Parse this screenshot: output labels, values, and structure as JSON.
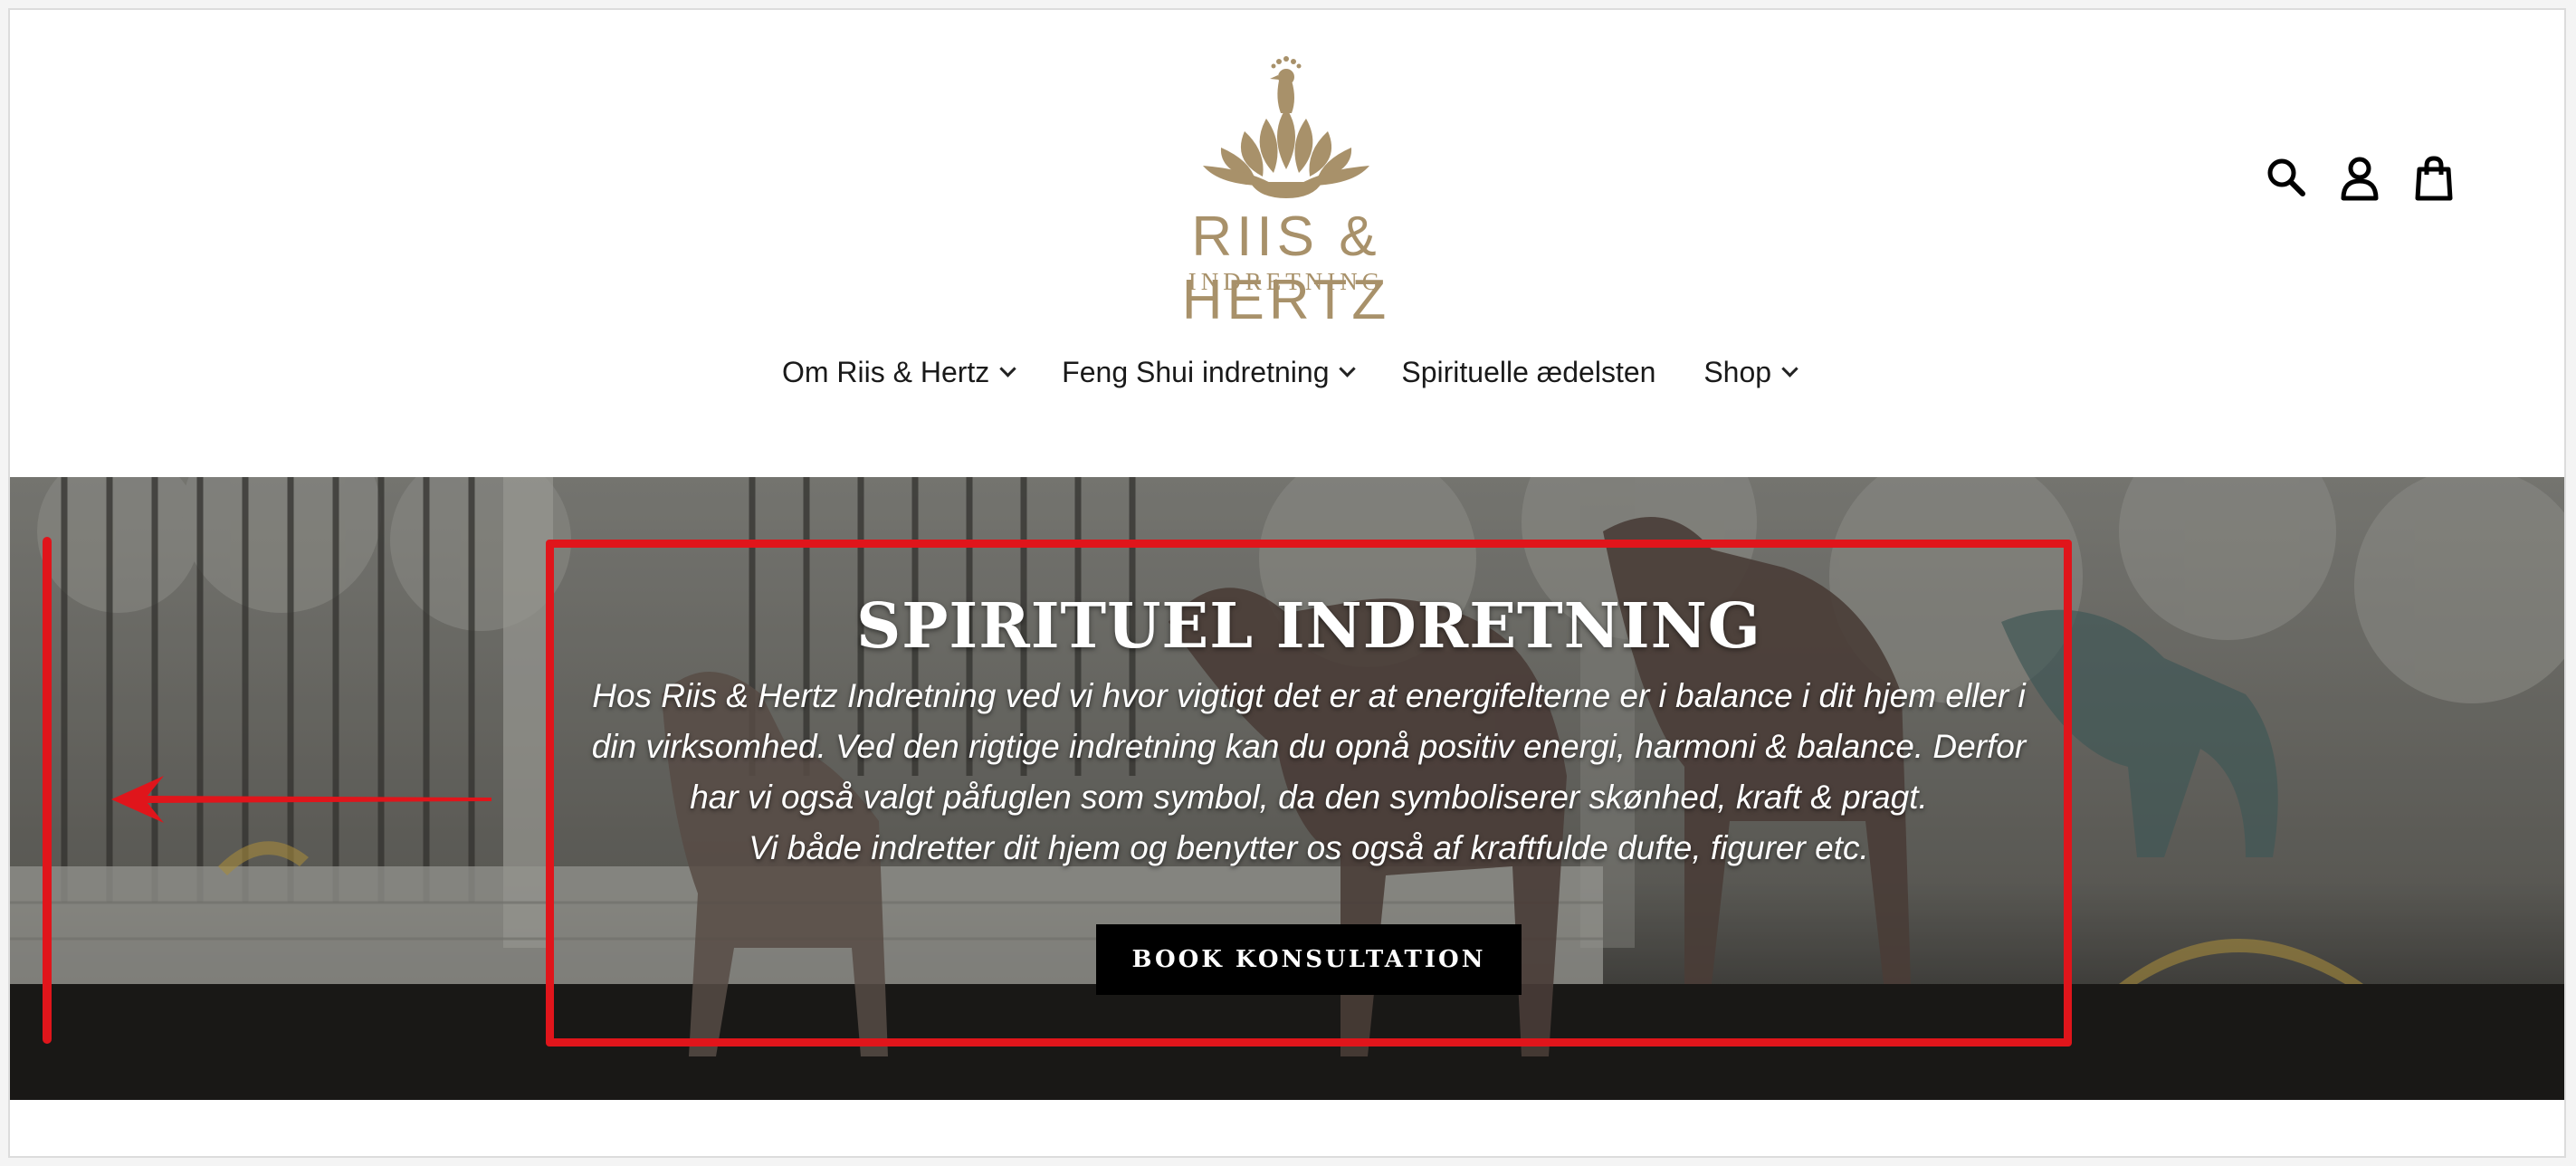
{
  "brand": {
    "name": "RIIS & HERTZ",
    "subtitle": "INDRETNING",
    "color": "#a8916a"
  },
  "header": {
    "icons": [
      "search-icon",
      "account-icon",
      "cart-icon"
    ]
  },
  "nav": {
    "items": [
      {
        "label": "Om Riis & Hertz",
        "has_dropdown": true
      },
      {
        "label": "Feng Shui indretning",
        "has_dropdown": true
      },
      {
        "label": "Spirituelle ædelsten",
        "has_dropdown": false
      },
      {
        "label": "Shop",
        "has_dropdown": true
      }
    ]
  },
  "hero": {
    "title": "SPIRITUEL INDRETNING",
    "lines": [
      "Hos Riis & Hertz Indretning ved vi hvor vigtigt det er at energifelterne er i balance i dit hjem eller i",
      "din virksomhed. Ved den rigtige indretning kan du opnå positiv energi, harmoni & balance. Derfor",
      "har vi også valgt påfuglen som symbol, da den symboliserer skønhed, kraft & pragt.",
      "Vi både indretter dit hjem og benytter os også af kraftfulde dufte, figurer etc."
    ],
    "button_label": "BOOK KONSULTATION"
  },
  "annotation": {
    "color": "#e0151b"
  }
}
